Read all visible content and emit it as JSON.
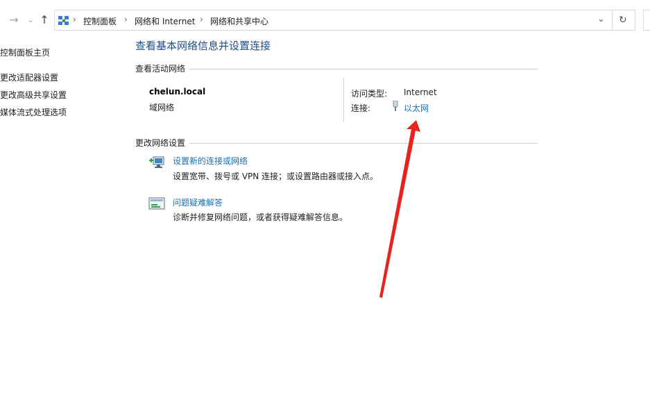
{
  "address_bar": {
    "breadcrumbs": [
      "控制面板",
      "网络和 Internet",
      "网络和共享中心"
    ]
  },
  "sidebar": {
    "items": [
      {
        "label": "控制面板主页"
      },
      {
        "label": "更改适配器设置"
      },
      {
        "label": "更改高级共享设置"
      },
      {
        "label": "媒体流式处理选项"
      }
    ]
  },
  "main": {
    "title": "查看基本网络信息并设置连接",
    "active_networks": {
      "heading": "查看活动网络",
      "network_name": "chelun.local",
      "network_type": "域网络",
      "access_type_label": "访问类型:",
      "access_type_value": "Internet",
      "connection_label": "连接:",
      "connection_value": "以太网"
    },
    "change_settings": {
      "heading": "更改网络设置",
      "tasks": [
        {
          "link": "设置新的连接或网络",
          "description": "设置宽带、拨号或 VPN 连接；或设置路由器或接入点。",
          "icon": "new-connection-icon"
        },
        {
          "link": "问题疑难解答",
          "description": "诊断并修复网络问题，或者获得疑难解答信息。",
          "icon": "troubleshoot-icon"
        }
      ]
    }
  },
  "annotation": {
    "arrow_color": "#e8231e"
  },
  "colors": {
    "link": "#1a6fb5",
    "title": "#1a4d8a"
  }
}
